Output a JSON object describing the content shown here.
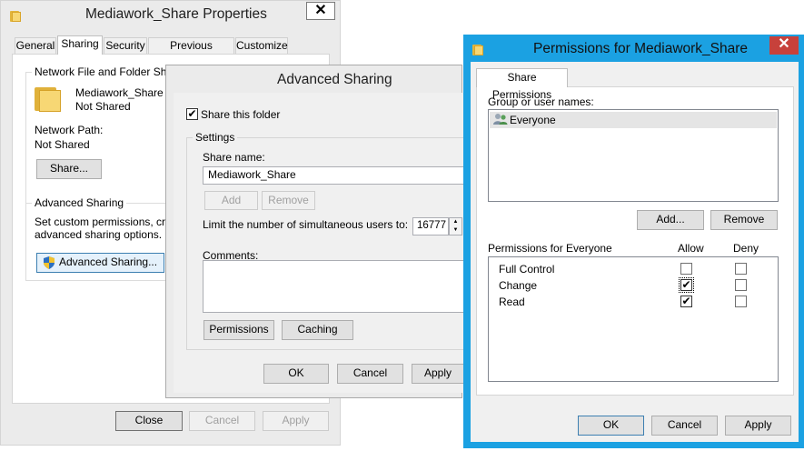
{
  "properties": {
    "title": "Mediawork_Share Properties",
    "tabs": [
      {
        "label": "General"
      },
      {
        "label": "Sharing"
      },
      {
        "label": "Security"
      },
      {
        "label": "Previous Versions"
      },
      {
        "label": "Customize"
      }
    ],
    "network_group_label": "Network File and Folder Sharing",
    "folder_name": "Mediawork_Share",
    "folder_status": "Not Shared",
    "network_path_label": "Network Path:",
    "network_path_value": "Not Shared",
    "share_button": "Share...",
    "advanced_group_label": "Advanced Sharing",
    "advanced_desc_line1": "Set custom permissions, create",
    "advanced_desc_line2": "advanced sharing options.",
    "advanced_button": "Advanced Sharing...",
    "close_button": "Close",
    "cancel_button": "Cancel",
    "apply_button": "Apply"
  },
  "advanced": {
    "title": "Advanced Sharing",
    "share_checkbox_label": "Share this folder",
    "share_checked": true,
    "settings_label": "Settings",
    "share_name_label": "Share name:",
    "share_name_value": "Mediawork_Share",
    "add_button": "Add",
    "remove_button": "Remove",
    "limit_label": "Limit the number of simultaneous users to:",
    "limit_value": "16777",
    "comments_label": "Comments:",
    "permissions_button": "Permissions",
    "caching_button": "Caching",
    "ok_button": "OK",
    "cancel_button": "Cancel",
    "apply_button": "Apply"
  },
  "permissions": {
    "title": "Permissions for Mediawork_Share",
    "close_glyph": "✕",
    "tab_label": "Share Permissions",
    "group_label": "Group or user names:",
    "users": [
      {
        "name": "Everyone"
      }
    ],
    "add_button": "Add...",
    "remove_button": "Remove",
    "perm_header": "Permissions for Everyone",
    "allow_header": "Allow",
    "deny_header": "Deny",
    "rows": [
      {
        "name": "Full Control",
        "allow": false,
        "deny": false
      },
      {
        "name": "Change",
        "allow": true,
        "deny": false
      },
      {
        "name": "Read",
        "allow": true,
        "deny": false
      }
    ],
    "ok_button": "OK",
    "cancel_button": "Cancel",
    "apply_button": "Apply"
  },
  "colors": {
    "perm_frame": "#1ba1e2",
    "close_red": "#c7413b",
    "window_bg": "#f0f0f0",
    "frame_inactive": "#ebebeb"
  }
}
